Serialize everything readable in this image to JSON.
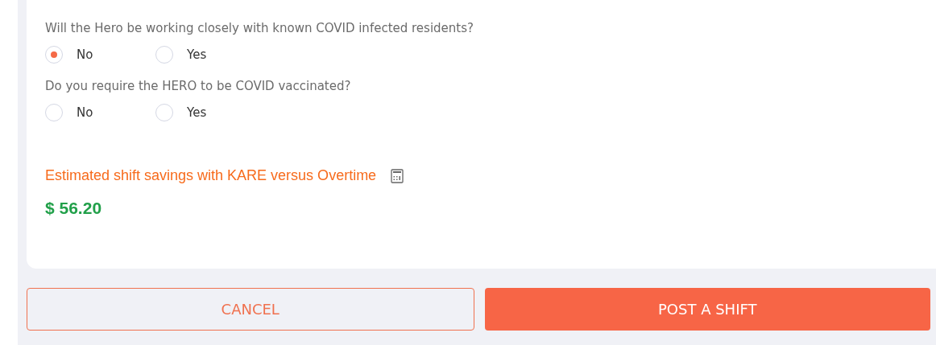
{
  "questions": [
    {
      "text": "Will the Hero be working closely with known COVID infected residents?",
      "options": [
        {
          "label": "No",
          "selected": true
        },
        {
          "label": "Yes",
          "selected": false
        }
      ]
    },
    {
      "text": "Do you require the HERO to be COVID vaccinated?",
      "options": [
        {
          "label": "No",
          "selected": false
        },
        {
          "label": "Yes",
          "selected": false
        }
      ]
    }
  ],
  "savings": {
    "label": "Estimated shift savings with KARE versus Overtime",
    "amount": "$ 56.20"
  },
  "buttons": [
    {
      "kind": "outline",
      "label": "CANCEL"
    },
    {
      "kind": "primary",
      "label": "POST A SHIFT"
    }
  ]
}
